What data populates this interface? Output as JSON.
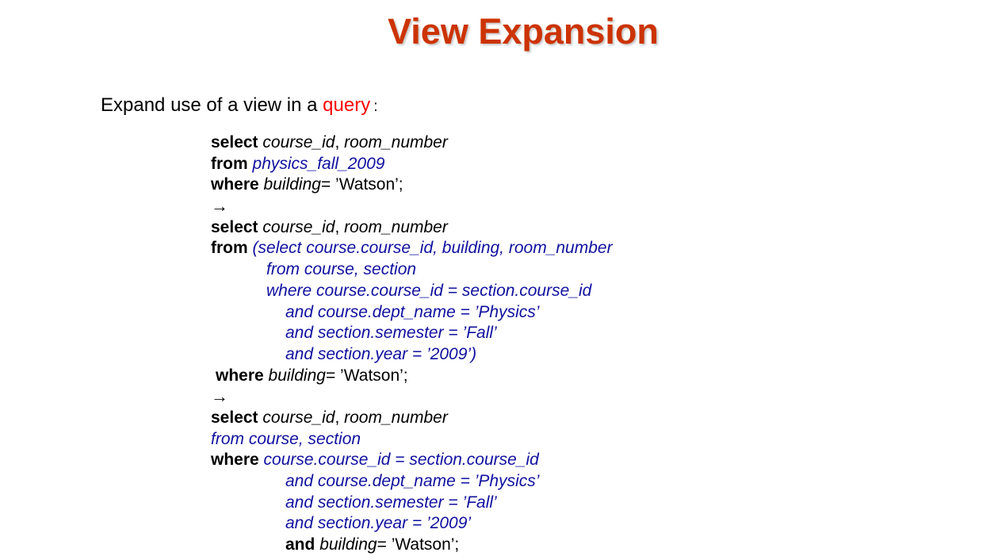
{
  "title": "View Expansion",
  "intro": {
    "text": "Expand use of a view in a ",
    "highlight": "query",
    "colon": ":"
  },
  "query1": {
    "select_kw": "select",
    "select_cols_a": "course_id",
    "comma": ", ",
    "select_cols_b": "room_number",
    "from_kw": "from",
    "from_view": "physics_fall_2009",
    "where_kw": "where",
    "where_attr": "building",
    "where_rest": "= ’Watson’;"
  },
  "arrow1": "→",
  "query2": {
    "select_kw": "select",
    "select_cols_a": "course_id",
    "comma": ", ",
    "select_cols_b": "room_number",
    "from_kw": "from",
    "sub_line1": "(select course.course_id, building, room_number",
    "sub_line2": "from course, section",
    "sub_line3": "where course.course_id = section.course_id",
    "sub_line4": "and course.dept_name = ’Physics’",
    "sub_line5": "and section.semester = ’Fall’",
    "sub_line6": "and section.year = ’2009’)",
    "where_kw": "where",
    "where_attr": "building",
    "where_rest": "= ’Watson’;"
  },
  "arrow2": "→",
  "query3": {
    "select_kw": "select",
    "select_cols_a": "course_id",
    "comma": ", ",
    "select_cols_b": "room_number",
    "from_line": "from course, section",
    "where_kw": "where",
    "where_cond": "course.course_id = section.course_id",
    "and1": "and course.dept_name = ’Physics’",
    "and2": "and section.semester = ’Fall’",
    "and3": "and section.year = ’2009’",
    "and_kw": "and",
    "and_attr": "building",
    "and_rest": "= ’Watson’;"
  }
}
